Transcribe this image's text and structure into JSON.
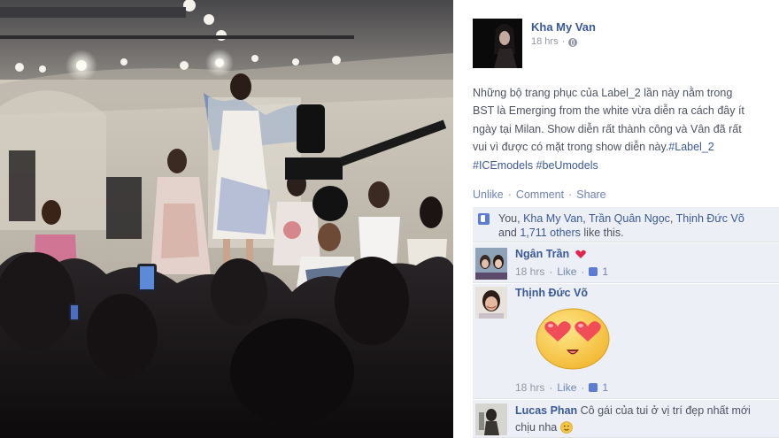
{
  "post": {
    "author": "Kha My Van",
    "time": "18 hrs",
    "privacy_icon": "globe-icon",
    "text_lines": [
      "Những bộ trang phục của Label_2 lần này nằm trong",
      "BST là Emerging from the white vừa diễn ra cách đây ít",
      "ngày tại Milan. Show diễn rất thành công và Vân đã rất",
      "vui vì được có mặt trong show diễn này."
    ],
    "hashtag_inline": "#Label_2",
    "hashtags_last": "#ICEmodels #beUmodels"
  },
  "actions": {
    "unlike": "Unlike",
    "comment": "Comment",
    "share": "Share",
    "separator": "·"
  },
  "likes": {
    "prefix": "You,",
    "name1": "Kha My Van",
    "name2": "Trần Quân Ngọc",
    "name3": "Thịnh Đức Võ",
    "and": "and",
    "others": "1,711 others",
    "suffix": "like this."
  },
  "comments": [
    {
      "name": "Ngân Trần",
      "text": "",
      "time": "18 hrs",
      "like": "Like",
      "like_count": "1"
    },
    {
      "name": "Thịnh Đức Võ",
      "text": "",
      "time": "18 hrs",
      "like": "Like",
      "like_count": "1",
      "sticker": "heart-eyes-emoji-sticker"
    },
    {
      "name": "Lucas Phan",
      "text": "Cô gái của tui ở vị trí đẹp nhất mới",
      "text2": "chịu nha",
      "emoticon": "wink-emoji-icon"
    }
  ],
  "colors": {
    "link": "#3b5998",
    "comment_bg": "#eceff5",
    "muted": "#9197a3",
    "text": "#4d5361"
  }
}
